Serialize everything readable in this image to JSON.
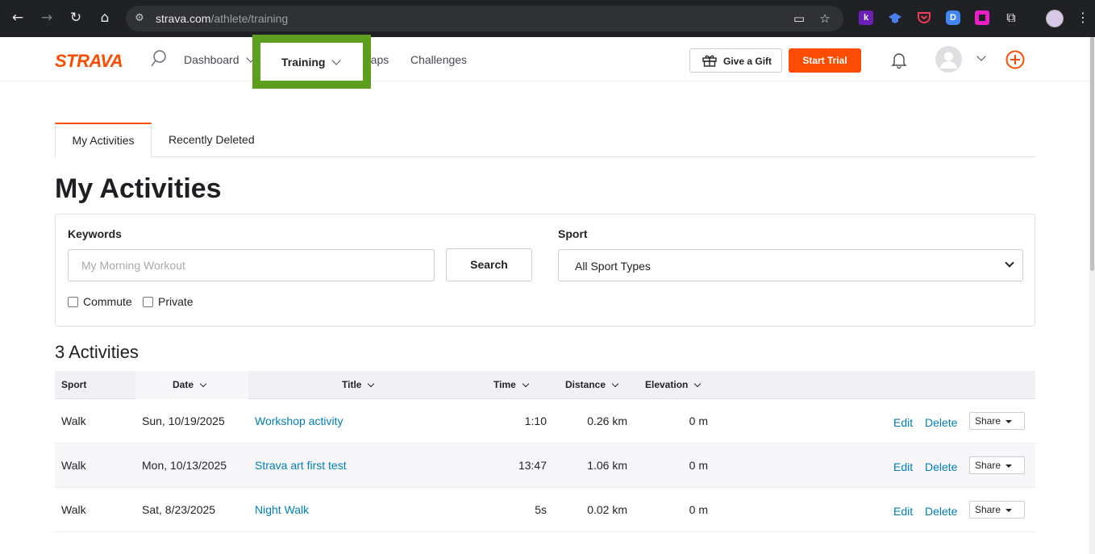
{
  "browser": {
    "url_host": "strava.com",
    "url_path": "/athlete/training",
    "back_icon": "←",
    "forward_icon": "→",
    "reload_icon": "↻",
    "home_icon": "⌂",
    "extensions": [
      {
        "name": "k",
        "color": "#6a1fb5"
      },
      {
        "name": "",
        "color": "#4a7ee8"
      },
      {
        "name": "",
        "color": "#ef3f56"
      },
      {
        "name": "D",
        "color": "#4285f4"
      },
      {
        "name": "",
        "color": "#e91ec4"
      }
    ]
  },
  "header": {
    "logo": "STRAVA",
    "nav": {
      "dashboard": "Dashboard",
      "training": "Training",
      "maps": "Maps",
      "challenges": "Challenges"
    },
    "gift_label": "Give a Gift",
    "trial_label": "Start Trial",
    "accent": "#fc4c02",
    "highlight_color": "#5e9e1e"
  },
  "tabs": {
    "my_activities": "My Activities",
    "recently_deleted": "Recently Deleted"
  },
  "page_title": "My Activities",
  "filter": {
    "keywords_label": "Keywords",
    "keywords_placeholder": "My Morning Workout",
    "search_label": "Search",
    "sport_label": "Sport",
    "sport_value": "All Sport Types",
    "commute_label": "Commute",
    "private_label": "Private"
  },
  "results_count": "3 Activities",
  "table": {
    "headers": {
      "sport": "Sport",
      "date": "Date",
      "title": "Title",
      "time": "Time",
      "distance": "Distance",
      "elevation": "Elevation"
    },
    "rows": [
      {
        "sport": "Walk",
        "date": "Sun, 10/19/2025",
        "title": "Workshop activity",
        "time": "1:10",
        "distance": "0.26 km",
        "elevation": "0 m",
        "edit": "Edit",
        "delete": "Delete",
        "share": "Share"
      },
      {
        "sport": "Walk",
        "date": "Mon, 10/13/2025",
        "title": "Strava art first test",
        "time": "13:47",
        "distance": "1.06 km",
        "elevation": "0 m",
        "edit": "Edit",
        "delete": "Delete",
        "share": "Share"
      },
      {
        "sport": "Walk",
        "date": "Sat, 8/23/2025",
        "title": "Night Walk",
        "time": "5s",
        "distance": "0.02 km",
        "elevation": "0 m",
        "edit": "Edit",
        "delete": "Delete",
        "share": "Share"
      }
    ]
  }
}
